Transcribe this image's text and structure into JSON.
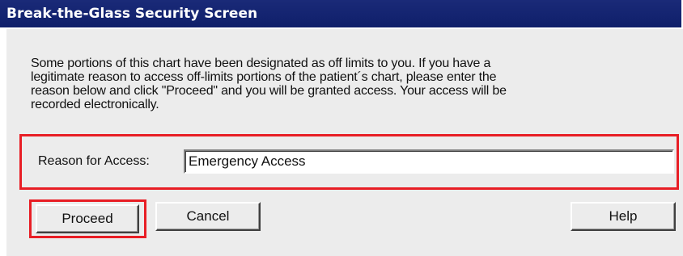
{
  "window": {
    "title": "Break-the-Glass Security Screen"
  },
  "message": {
    "lines": [
      "Some portions of this chart have been designated as off limits to you.  If you have a",
      "legitimate reason to access off-limits portions of the patient´s chart, please enter the",
      "reason below and click \"Proceed\" and you will be granted access.  Your access will be",
      "recorded electronically."
    ]
  },
  "reason": {
    "label": "Reason for Access:",
    "value": "Emergency Access"
  },
  "buttons": {
    "proceed": "Proceed",
    "cancel": "Cancel",
    "help": "Help"
  },
  "colors": {
    "titlebar": "#0f1f6a",
    "highlight": "#e81e25",
    "dialog_background": "#ececec"
  }
}
